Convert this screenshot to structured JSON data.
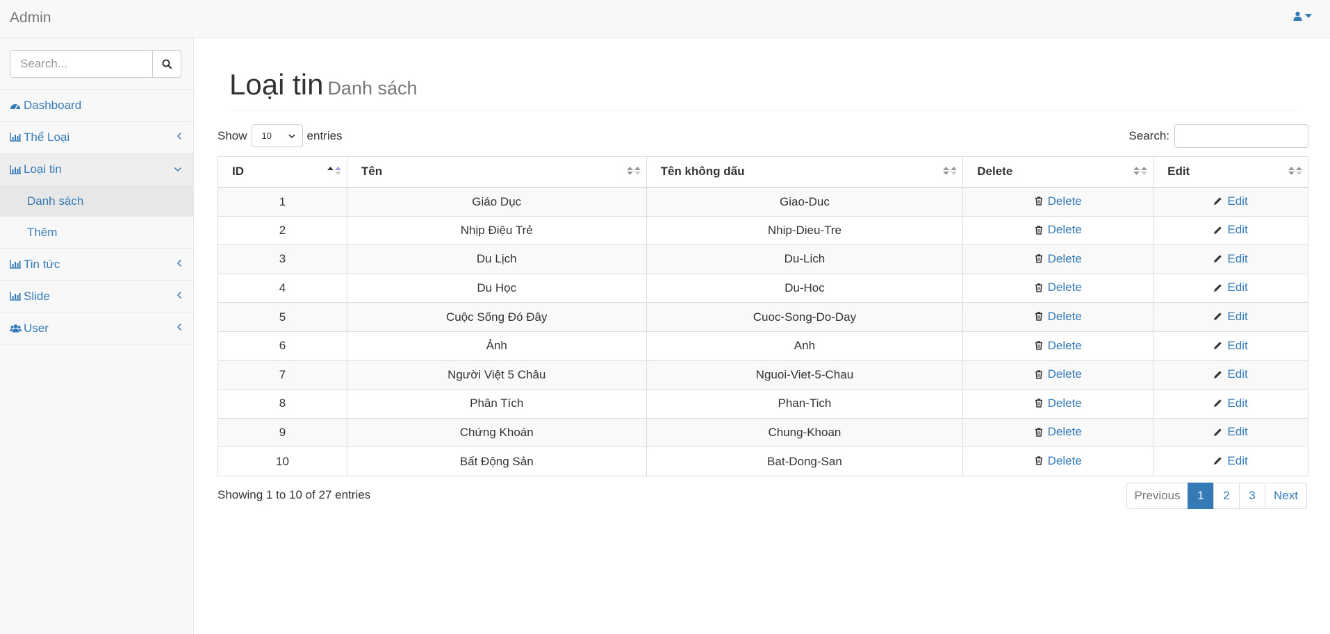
{
  "app": {
    "brand": "Admin"
  },
  "sidebar": {
    "search_placeholder": "Search...",
    "items": [
      {
        "label": "Dashboard",
        "icon": "dashboard-icon"
      },
      {
        "label": "Thể Loại",
        "icon": "bar-chart-icon"
      },
      {
        "label": "Loại tin",
        "icon": "bar-chart-icon",
        "subitems": [
          "Danh sách",
          "Thêm"
        ]
      },
      {
        "label": "Tin tức",
        "icon": "bar-chart-icon"
      },
      {
        "label": "Slide",
        "icon": "bar-chart-icon"
      },
      {
        "label": "User",
        "icon": "users-icon"
      }
    ]
  },
  "page": {
    "title": "Loại tin",
    "subtitle": "Danh sách"
  },
  "datatable": {
    "show_label": "Show",
    "entries_label": "entries",
    "page_length": "10",
    "search_label": "Search:",
    "columns": [
      "ID",
      "Tên",
      "Tên không dấu",
      "Delete",
      "Edit"
    ],
    "rows": [
      [
        "1",
        "Giáo Dục",
        "Giao-Duc",
        "Delete",
        "Edit"
      ],
      [
        "2",
        "Nhịp Điệu Trẻ",
        "Nhip-Dieu-Tre",
        "Delete",
        "Edit"
      ],
      [
        "3",
        "Du Lịch",
        "Du-Lich",
        "Delete",
        "Edit"
      ],
      [
        "4",
        "Du Học",
        "Du-Hoc",
        "Delete",
        "Edit"
      ],
      [
        "5",
        "Cuộc Sống Đó Đây",
        "Cuoc-Song-Do-Day",
        "Delete",
        "Edit"
      ],
      [
        "6",
        "Ảnh",
        "Anh",
        "Delete",
        "Edit"
      ],
      [
        "7",
        "Người Việt 5 Châu",
        "Nguoi-Viet-5-Chau",
        "Delete",
        "Edit"
      ],
      [
        "8",
        "Phân Tích",
        "Phan-Tich",
        "Delete",
        "Edit"
      ],
      [
        "9",
        "Chứng Khoán",
        "Chung-Khoan",
        "Delete",
        "Edit"
      ],
      [
        "10",
        "Bất Động Sản",
        "Bat-Dong-San",
        "Delete",
        "Edit"
      ]
    ],
    "info": "Showing 1 to 10 of 27 entries",
    "pagination": {
      "previous": "Previous",
      "pages": [
        "1",
        "2",
        "3"
      ],
      "active_page": "1",
      "next": "Next"
    }
  },
  "colors": {
    "link": "#337ab7",
    "active_page": "#337ab7",
    "sidebar_bg": "#f8f8f8"
  }
}
